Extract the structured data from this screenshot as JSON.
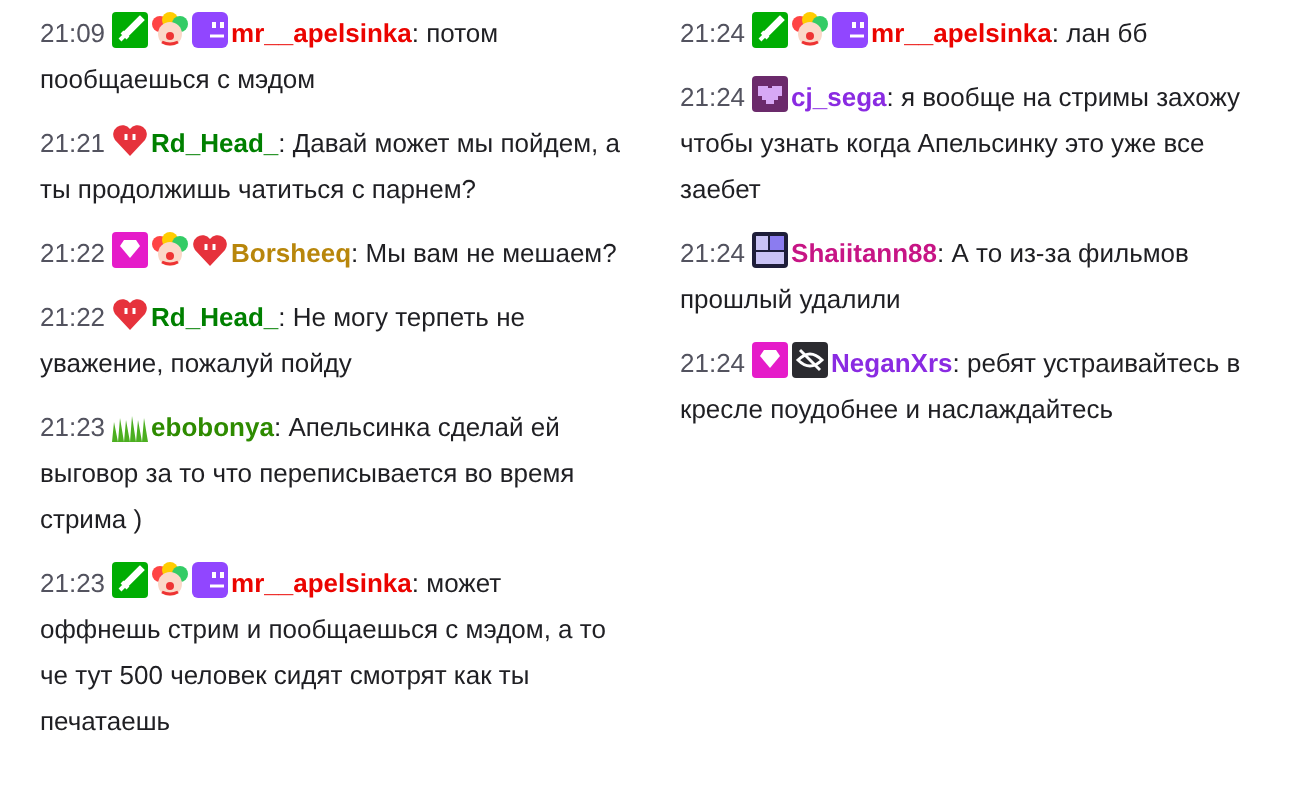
{
  "columns": [
    {
      "messages": [
        {
          "time": "21:09",
          "badges": [
            {
              "kind": "sword"
            },
            {
              "kind": "clown"
            },
            {
              "kind": "face"
            }
          ],
          "user": "mr__apelsinka",
          "color": "#eb0400",
          "sep": ":",
          "text": "потом пообщаешься с мэдом"
        },
        {
          "time": "21:21",
          "badges": [
            {
              "kind": "heart"
            }
          ],
          "user": "Rd_Head_",
          "color": "#008000",
          "sep": ":",
          "text": "Давай может мы пойдем, а ты продолжишь чатиться с парнем?"
        },
        {
          "time": "21:22",
          "badges": [
            {
              "kind": "gem"
            },
            {
              "kind": "clown"
            },
            {
              "kind": "heart"
            }
          ],
          "user": "Borsheeq",
          "color": "#b8860b",
          "sep": ":",
          "text": "Мы вам не мешаем?"
        },
        {
          "time": "21:22",
          "badges": [
            {
              "kind": "heart"
            }
          ],
          "user": "Rd_Head_",
          "color": "#008000",
          "sep": ":",
          "text": "Не могу терпеть не уважение, пожалуй пойду"
        },
        {
          "time": "21:23",
          "badges": [
            {
              "kind": "grass"
            }
          ],
          "user": "ebobonya",
          "color": "#2e8b00",
          "sep": ":",
          "text": "Апельсинка сделай ей выговор за то что переписывается во время стрима )"
        },
        {
          "time": "21:23",
          "badges": [
            {
              "kind": "sword"
            },
            {
              "kind": "clown"
            },
            {
              "kind": "face"
            }
          ],
          "user": "mr__apelsinka",
          "color": "#eb0400",
          "sep": ":",
          "text": "может оффнешь стрим и пообщаешься с мэдом, а то че тут 500 человек сидят смотрят как ты печатаешь"
        }
      ]
    },
    {
      "messages": [
        {
          "time": "21:24",
          "badges": [
            {
              "kind": "sword"
            },
            {
              "kind": "clown"
            },
            {
              "kind": "face"
            }
          ],
          "user": "mr__apelsinka",
          "color": "#eb0400",
          "sep": ":",
          "text": "лан бб"
        },
        {
          "time": "21:24",
          "badges": [
            {
              "kind": "pixel-heart"
            }
          ],
          "user": "cj_sega",
          "color": "#8a2be2",
          "sep": ":",
          "text": "я вообще на стримы захожу чтобы узнать когда Апельсинку это уже все заебет"
        },
        {
          "time": "21:24",
          "badges": [
            {
              "kind": "year"
            }
          ],
          "user": "Shaiitann88",
          "color": "#c71585",
          "sep": ":",
          "text": "А то из-за фильмов прошлый удалили"
        },
        {
          "time": "21:24",
          "badges": [
            {
              "kind": "gem"
            },
            {
              "kind": "no-eye"
            }
          ],
          "user": "NeganXrs",
          "color": "#8a2be2",
          "sep": ":",
          "text": "ребят устраивайтесь в кресле поудобнее и наслаждайтесь"
        }
      ]
    }
  ]
}
